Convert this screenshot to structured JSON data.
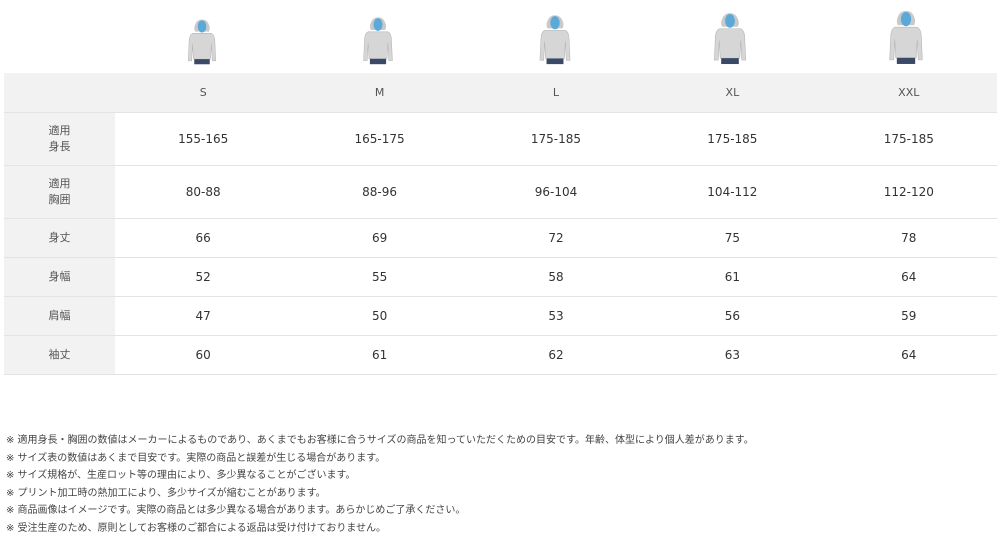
{
  "figures": [
    {
      "size": "S",
      "name": "model-figure-s"
    },
    {
      "size": "M",
      "name": "model-figure-m"
    },
    {
      "size": "L",
      "name": "model-figure-l"
    },
    {
      "size": "XL",
      "name": "model-figure-xl"
    },
    {
      "size": "XXL",
      "name": "model-figure-xxl"
    }
  ],
  "table": {
    "header": [
      "",
      "S",
      "M",
      "L",
      "XL",
      "XXL"
    ],
    "rows": [
      {
        "label": "適用\n身長",
        "values": [
          "155-165",
          "165-175",
          "175-185",
          "175-185",
          "175-185"
        ]
      },
      {
        "label": "適用\n胸囲",
        "values": [
          "80-88",
          "88-96",
          "96-104",
          "104-112",
          "112-120"
        ]
      },
      {
        "label": "身丈",
        "values": [
          "66",
          "69",
          "72",
          "75",
          "78"
        ]
      },
      {
        "label": "身幅",
        "values": [
          "52",
          "55",
          "58",
          "61",
          "64"
        ]
      },
      {
        "label": "肩幅",
        "values": [
          "47",
          "50",
          "53",
          "56",
          "59"
        ]
      },
      {
        "label": "袖丈",
        "values": [
          "60",
          "61",
          "62",
          "63",
          "64"
        ]
      }
    ]
  },
  "notes": [
    "※ 適用身長・胸囲の数値はメーカーによるものであり、あくまでもお客様に合うサイズの商品を知っていただくための目安です。年齢、体型により個人差があります。",
    "※ サイズ表の数値はあくまで目安です。実際の商品と誤差が生じる場合があります。",
    "※ サイズ規格が、生産ロット等の理由により、多少異なることがございます。",
    "※ プリント加工時の熱加工により、多少サイズが縮むことがあります。",
    "※ 商品画像はイメージです。実際の商品とは多少異なる場合があります。あらかじめご了承ください。",
    "※ 受注生産のため、原則としてお客様のご都合による返品は受け付けておりません。"
  ],
  "colors": {
    "skin": "#5aa9d8",
    "shirt": "#d6d6d6",
    "pants": "#3a4a66",
    "label_bg": "#f2f2f2"
  }
}
